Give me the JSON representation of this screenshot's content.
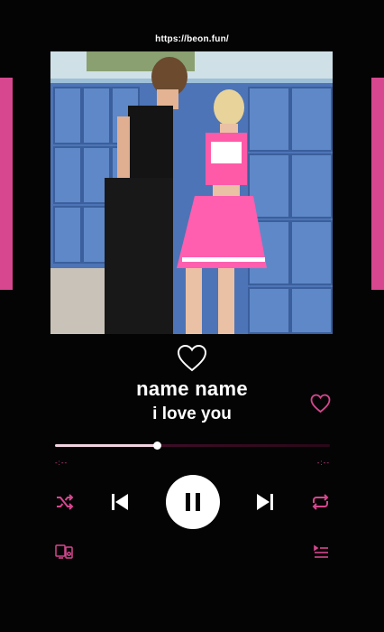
{
  "url": "https://beon.fun/",
  "track": {
    "title": "name name",
    "subtitle": "i love you"
  },
  "progress": {
    "fraction": 0.37,
    "elapsed": "-:--",
    "remaining": "-:--"
  },
  "colors": {
    "accent": "#d6478f",
    "background": "#040404",
    "text": "#ffffff"
  },
  "icons": {
    "like_top": "heart-outline-icon",
    "like_right": "heart-outline-icon",
    "shuffle": "shuffle-icon",
    "previous": "skip-previous-icon",
    "play_pause": "pause-icon",
    "next": "skip-next-icon",
    "repeat": "repeat-icon",
    "devices": "devices-icon",
    "queue": "queue-icon"
  }
}
